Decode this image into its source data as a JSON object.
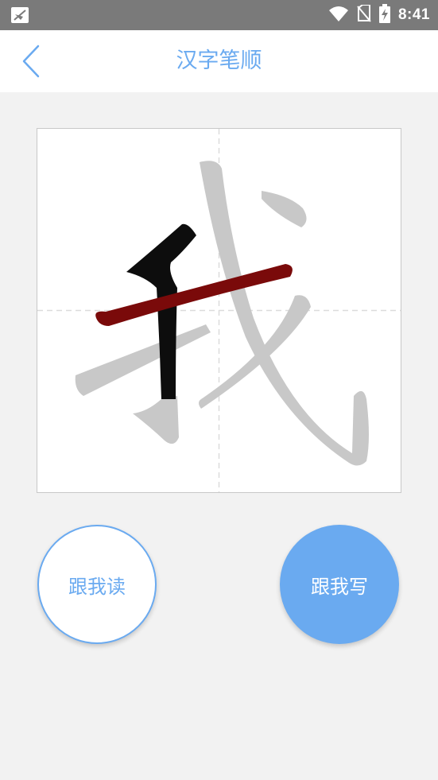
{
  "status_bar": {
    "time": "8:41",
    "icons": [
      "notification-icon",
      "wifi-icon",
      "no-sim-icon",
      "battery-charging-icon"
    ]
  },
  "header": {
    "title": "汉字笔顺",
    "back_icon": "chevron-left-icon"
  },
  "character": {
    "glyph": "我",
    "completed_stroke_color": "#0d0d0d",
    "current_stroke_color": "#7a0a0a",
    "remaining_stroke_color": "#c8c8c8",
    "guide_line_color": "#dcdcdc"
  },
  "actions": {
    "read_label": "跟我读",
    "write_label": "跟我写"
  },
  "colors": {
    "accent": "#6aaaf0",
    "status_bar": "#7a7a7a",
    "background": "#f2f2f2"
  }
}
